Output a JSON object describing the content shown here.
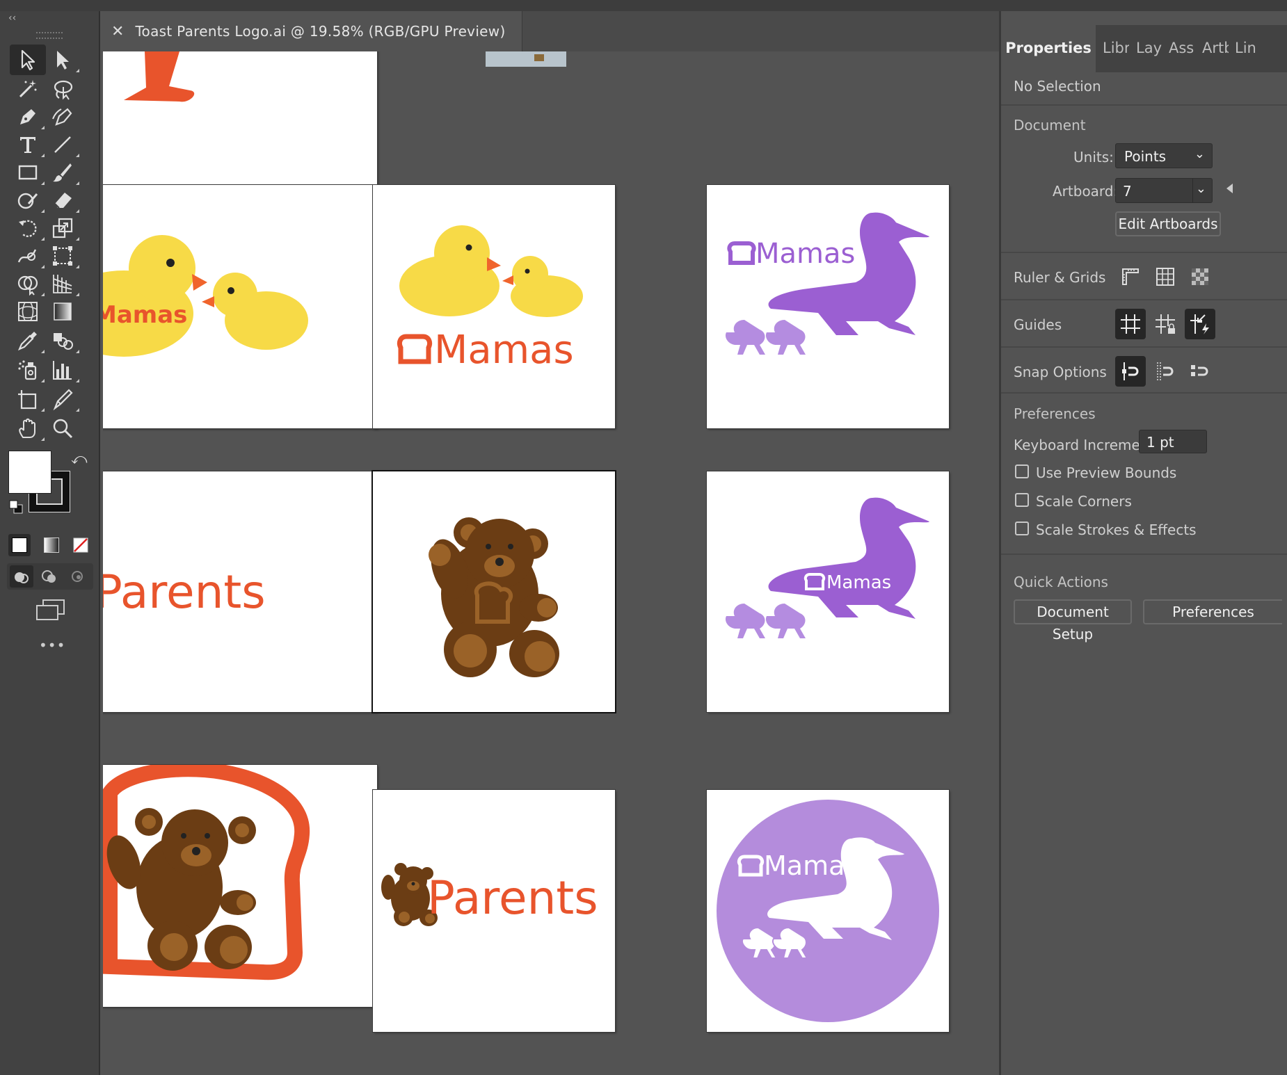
{
  "document_tab": {
    "close": "✕",
    "title": "Toast Parents Logo.ai @ 19.58% (RGB/GPU Preview)"
  },
  "toolbar": {
    "collapse": "‹‹",
    "more": "•••",
    "tools": [
      "selection-tool-icon",
      "direct-selection-tool-icon",
      "magic-wand-tool-icon",
      "lasso-tool-icon",
      "pen-tool-icon",
      "curvature-tool-icon",
      "type-tool-icon",
      "line-segment-tool-icon",
      "rectangle-tool-icon",
      "paintbrush-tool-icon",
      "shaper-tool-icon",
      "eraser-tool-icon",
      "rotate-tool-icon",
      "scale-tool-icon",
      "warp-tool-icon",
      "free-transform-tool-icon",
      "shape-builder-tool-icon",
      "perspective-grid-tool-icon",
      "mesh-tool-icon",
      "gradient-tool-icon",
      "eyedropper-tool-icon",
      "blend-tool-icon",
      "symbol-sprayer-tool-icon",
      "column-graph-tool-icon",
      "artboard-tool-icon",
      "slice-tool-icon",
      "hand-tool-icon",
      "zoom-tool-icon"
    ]
  },
  "artboards": {
    "brand_orange": "#e8542c",
    "duck_yellow": "#f7da47",
    "duck_beak": "#f0642c",
    "mama_purple": "#9b5fd2",
    "duckling_purple": "#b48ce0",
    "circle_purple": "#b48cdc",
    "bear_dark": "#6b3d14",
    "bear_light": "#9a6228",
    "mamas_label": "Mamas",
    "parents_label": "Parents"
  },
  "panel": {
    "tabs": [
      "Properties",
      "Libr",
      "Laye",
      "Ass",
      "Artb",
      "Lin"
    ],
    "no_selection": "No Selection",
    "document": {
      "header": "Document",
      "units_label": "Units:",
      "units_value": "Points",
      "artboard_label": "Artboard:",
      "artboard_value": "7",
      "edit_artboards": "Edit Artboards"
    },
    "ruler_grids": "Ruler & Grids",
    "guides": "Guides",
    "snap_options": "Snap Options",
    "preferences": {
      "header": "Preferences",
      "keyboard_increment_label": "Keyboard Increment:",
      "keyboard_increment_value": "1 pt",
      "use_preview_bounds": "Use Preview Bounds",
      "scale_corners": "Scale Corners",
      "scale_strokes_effects": "Scale Strokes & Effects"
    },
    "quick_actions": {
      "header": "Quick Actions",
      "document_setup": "Document Setup",
      "preferences": "Preferences"
    }
  }
}
